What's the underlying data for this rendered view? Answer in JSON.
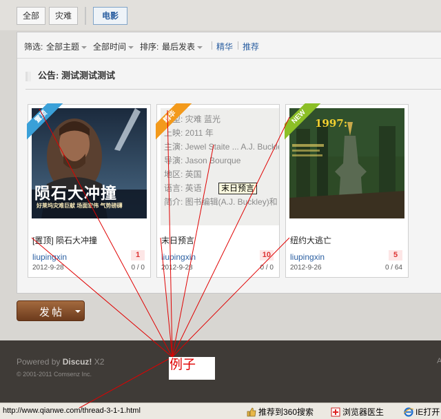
{
  "tabs": {
    "all": "全部",
    "disaster": "灾难",
    "movie": "电影"
  },
  "filters": {
    "prefix": "筛选:",
    "topic": "全部主题",
    "time": "全部时间",
    "sort_prefix": "排序:",
    "sort": "最后发表",
    "digest": "精华",
    "recommend": "推荐"
  },
  "notice": {
    "label": "公告:",
    "text": "测试测试测试"
  },
  "cards": [
    {
      "badge": "置顶",
      "badge_color": "#3aa0d8",
      "poster_title": "陨石大冲撞",
      "poster_tag": "好莱坞灾难巨献 场面宏伟 气势磅礴",
      "title": "[置顶] 陨石大冲撞",
      "author": "liupingxin",
      "count": "1",
      "date": "2012-9-28",
      "stats": "0 / 0"
    },
    {
      "badge": "精华",
      "badge_color": "#f39a1c",
      "title": "末日预言",
      "author": "liupingxin",
      "count": "10",
      "date": "2012-9-28",
      "stats": "0 / 0",
      "info": [
        "类型: 灾难 蓝光",
        "上映: 2011 年",
        "主演: Jewel Staite ... A.J. Buckley",
        "导演: Jason Bourque",
        "地区: 英国",
        "语言: 英语",
        "简介: 图书编辑(A.J. Buckley)和"
      ]
    },
    {
      "badge": "NEW",
      "badge_color": "#8cbf26",
      "poster_title": "1997:",
      "title": "纽约大逃亡",
      "author": "liupingxin",
      "count": "5",
      "date": "2012-9-26",
      "stats": "0 / 64"
    }
  ],
  "tooltip": "末日预言",
  "post_button": "发帖",
  "footer": {
    "powered": "Powered by",
    "brand": "Discuz!",
    "version": "X2",
    "copyright": "© 2001-2011 Comsenz Inc.",
    "right_fragment": "A"
  },
  "annotation": "例子",
  "status": {
    "url": "http://www.qianwe.com/thread-3-1-1.html",
    "item1": "推荐到360搜索",
    "item2": "浏览器医生",
    "item3": "IE打开"
  },
  "colors": {
    "link": "#2b5fa1",
    "annotation_red": "#e00000",
    "footer_bg": "#3f3b37",
    "post_button": "#8a5028"
  }
}
